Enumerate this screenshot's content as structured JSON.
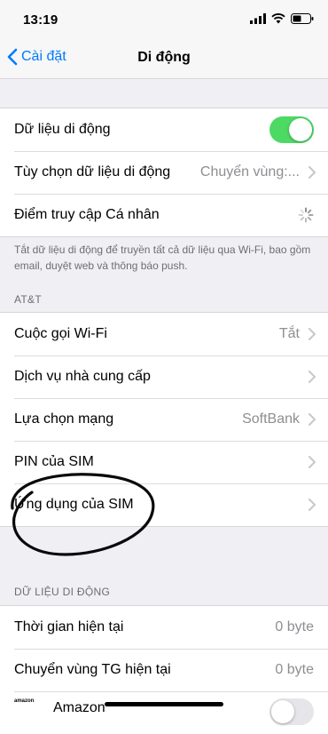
{
  "status": {
    "time": "13:19"
  },
  "nav": {
    "back_label": "Cài đặt",
    "title": "Di động"
  },
  "group1": {
    "rows": [
      {
        "label": "Dữ liệu di động",
        "toggle_on": true
      },
      {
        "label": "Tùy chọn dữ liệu di động",
        "value": "Chuyển vùng:..."
      },
      {
        "label": "Điểm truy cập Cá nhân"
      }
    ],
    "footer": "Tắt dữ liệu di động để truyền tất cả dữ liệu qua Wi-Fi, bao gồm email, duyệt web và thông báo push."
  },
  "group2": {
    "header": "AT&T",
    "rows": [
      {
        "label": "Cuộc gọi Wi-Fi",
        "value": "Tắt"
      },
      {
        "label": "Dịch vụ nhà cung cấp"
      },
      {
        "label": "Lựa chọn mạng",
        "value": "SoftBank"
      },
      {
        "label": "PIN của SIM"
      },
      {
        "label": "Ứng dụng của SIM"
      }
    ]
  },
  "group3": {
    "header": "DỮ LIỆU DI ĐỘNG",
    "rows": [
      {
        "label": "Thời gian hiện tại",
        "value": "0 byte"
      },
      {
        "label": "Chuyển vùng TG hiện tại",
        "value": "0 byte"
      },
      {
        "label": "Amazon",
        "icon_text": "amazon"
      }
    ]
  },
  "colors": {
    "accent": "#007aff",
    "toggle_on": "#4cd964",
    "background": "#efeff4"
  }
}
